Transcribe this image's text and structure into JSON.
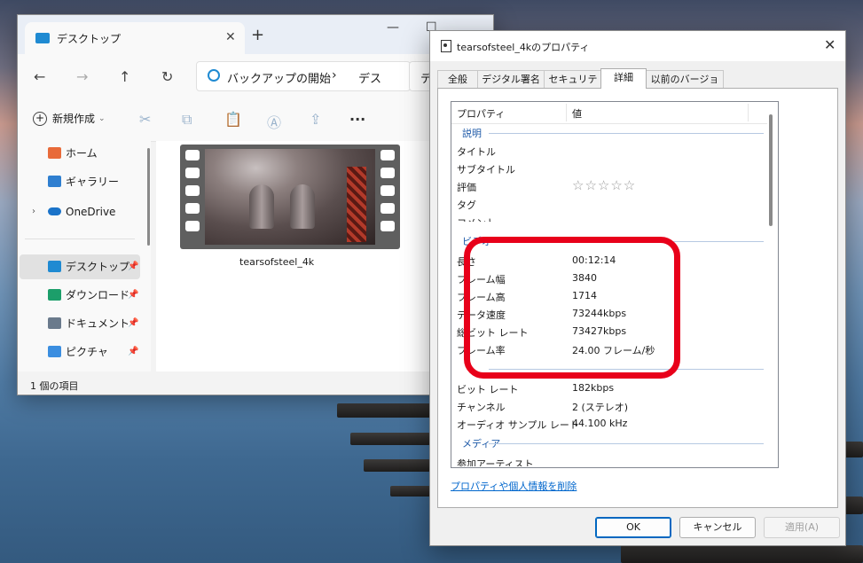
{
  "explorer": {
    "tab_title": "デスクトップ",
    "tab_close": "✕",
    "new_tab": "+",
    "minimize": "—",
    "maximize": "☐",
    "nav": {
      "back": "←",
      "forward": "→",
      "up": "↑",
      "refresh": "↻"
    },
    "address_part1": "バックアップの開始",
    "address_sep": "›",
    "address_part2": "デス",
    "search_fragment": "デ",
    "new_button": "新規作成",
    "sidebar": [
      {
        "label": "ホーム",
        "pin": ""
      },
      {
        "label": "ギャラリー",
        "pin": ""
      },
      {
        "label": "OneDrive",
        "pin": ""
      },
      {
        "label": "デスクトップ",
        "pin": "📌"
      },
      {
        "label": "ダウンロード",
        "pin": "📌"
      },
      {
        "label": "ドキュメント",
        "pin": "📌"
      },
      {
        "label": "ピクチャ",
        "pin": "📌"
      }
    ],
    "sidebar_caret": "›",
    "file_name": "tearsofsteel_4k",
    "status_text": "1 個の項目"
  },
  "dialog": {
    "title": "tearsofsteel_4kのプロパティ",
    "close": "✕",
    "tabs": [
      "全般",
      "デジタル署名",
      "セキュリティ",
      "詳細",
      "以前のバージョン"
    ],
    "columns": {
      "property": "プロパティ",
      "value": "値"
    },
    "groups": {
      "description": "説明",
      "video": "ビデオ",
      "media": "メディア"
    },
    "description_rows": [
      {
        "key": "タイトル",
        "value": ""
      },
      {
        "key": "サブタイトル",
        "value": ""
      },
      {
        "key": "評価",
        "value": ""
      },
      {
        "key": "タグ",
        "value": ""
      },
      {
        "key": "コメント",
        "value": ""
      }
    ],
    "rating_stars": "☆☆☆☆☆",
    "video_rows": [
      {
        "key": "長さ",
        "value": "00:12:14"
      },
      {
        "key": "フレーム幅",
        "value": "3840"
      },
      {
        "key": "フレーム高",
        "value": "1714"
      },
      {
        "key": "データ速度",
        "value": "73244kbps"
      },
      {
        "key": "総ビット レート",
        "value": "73427kbps"
      },
      {
        "key": "フレーム率",
        "value": "24.00 フレーム/秒"
      }
    ],
    "audio_rows": [
      {
        "key": "ビット レート",
        "value": "182kbps"
      },
      {
        "key": "チャンネル",
        "value": "2 (ステレオ)"
      },
      {
        "key": "オーディオ サンプル レート",
        "value": "44.100 kHz"
      }
    ],
    "media_rows": [
      {
        "key": "参加アーティスト",
        "value": ""
      }
    ],
    "remove_link": "プロパティや個人情報を削除",
    "buttons": {
      "ok": "OK",
      "cancel": "キャンセル",
      "apply": "適用(A)"
    }
  },
  "colors": {
    "highlight": "#e8001a",
    "link": "#0066cc",
    "group": "#1e5aa8"
  }
}
